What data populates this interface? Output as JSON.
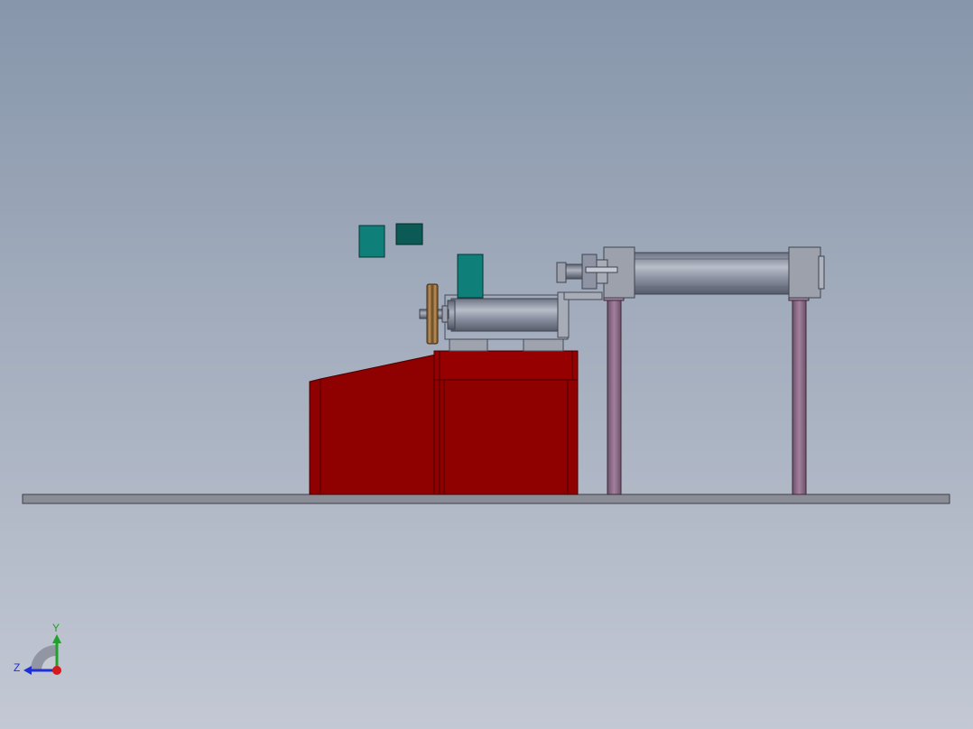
{
  "viewport": {
    "background_top": "#8796ab",
    "background_bottom": "#c3c8d4"
  },
  "model": {
    "base_plate_color": "#8a8d96",
    "enclosure_color": "#8f0000",
    "enclosure_edge": "#5a0000",
    "cylinder_color": "#8e94a3",
    "frame_post_color": "#8d6b8a",
    "teal_block_color": "#0f7f7a",
    "teal_block_dark": "#0b5a55",
    "pulley_color": "#b07a3a"
  },
  "triad": {
    "y_label": "Y",
    "z_label": "Z",
    "y_color": "#1fa12a",
    "z_color": "#1e2fd6",
    "x_color": "#d41a1a"
  }
}
